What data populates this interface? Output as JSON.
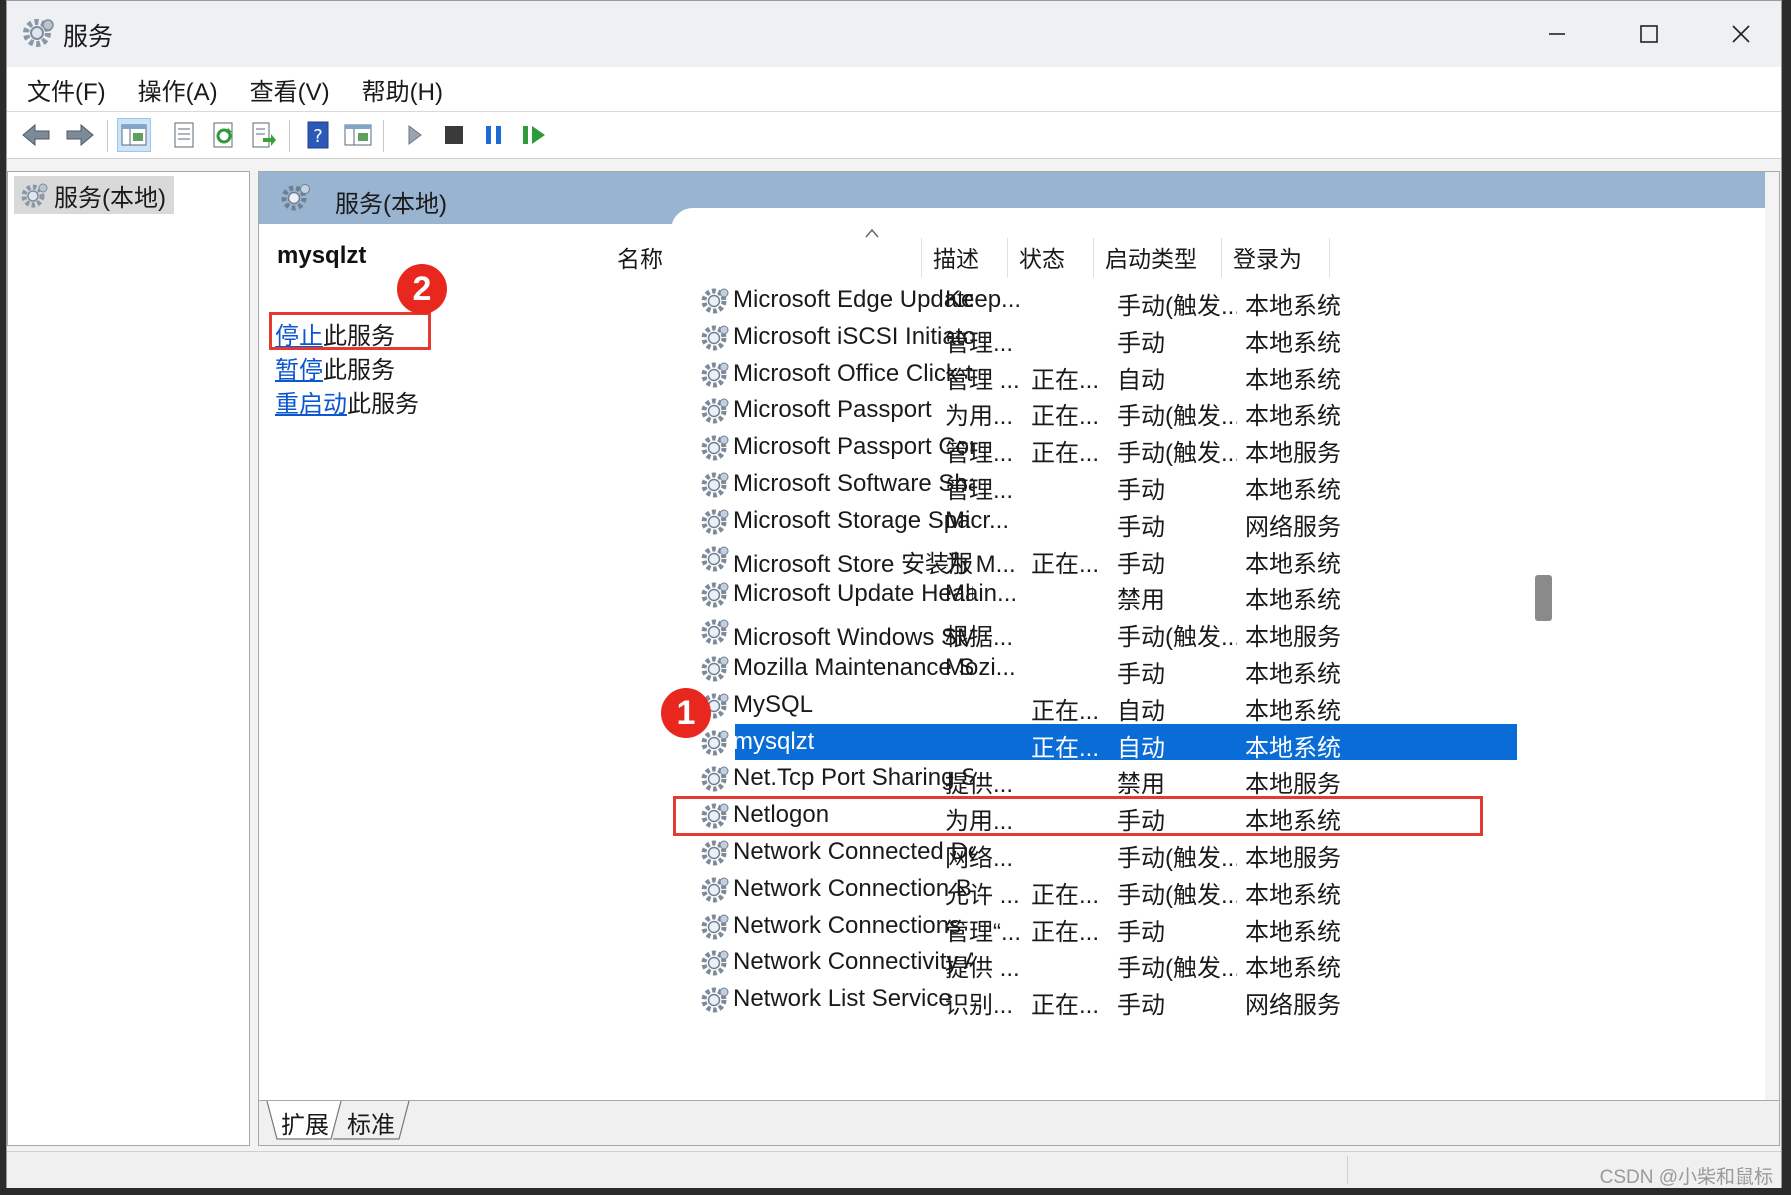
{
  "window": {
    "title": "服务"
  },
  "menu": [
    "文件(F)",
    "操作(A)",
    "查看(V)",
    "帮助(H)"
  ],
  "toolbar": {
    "buttons": [
      "back-icon",
      "forward-icon",
      "console-tree-icon",
      "properties-icon",
      "refresh-icon",
      "export-list-icon",
      "help-icon",
      "details-view-icon",
      "start-service-icon",
      "stop-service-icon",
      "pause-service-icon",
      "resume-service-icon"
    ]
  },
  "tree": {
    "root_label": "服务(本地)"
  },
  "panel": {
    "header": "服务(本地)",
    "selected_service": "mysqlzt",
    "actions": [
      {
        "link": "停止",
        "suffix": "此服务"
      },
      {
        "link": "暂停",
        "suffix": "此服务"
      },
      {
        "link": "重启动",
        "suffix": "此服务"
      }
    ]
  },
  "annotations": {
    "badge1": "1",
    "badge2": "2"
  },
  "table": {
    "columns": [
      "名称",
      "描述",
      "状态",
      "启动类型",
      "登录为"
    ],
    "rows": [
      [
        "Microsoft Edge Update Ser...",
        "Keep...",
        "",
        "手动(触发...",
        "本地系统"
      ],
      [
        "Microsoft iSCSI Initiator Ser...",
        "管理...",
        "",
        "手动",
        "本地系统"
      ],
      [
        "Microsoft Office Click-to-R...",
        "管理 ...",
        "正在...",
        "自动",
        "本地系统"
      ],
      [
        "Microsoft Passport",
        "为用...",
        "正在...",
        "手动(触发...",
        "本地系统"
      ],
      [
        "Microsoft Passport Container",
        "管理...",
        "正在...",
        "手动(触发...",
        "本地服务"
      ],
      [
        "Microsoft Software Shado...",
        "管理...",
        "",
        "手动",
        "本地系统"
      ],
      [
        "Microsoft Storage Spaces S...",
        "Micr...",
        "",
        "手动",
        "网络服务"
      ],
      [
        "Microsoft Store 安装服务",
        "为 M...",
        "正在...",
        "手动",
        "本地系统"
      ],
      [
        "Microsoft Update Health S...",
        "Main...",
        "",
        "禁用",
        "本地系统"
      ],
      [
        "Microsoft Windows SMS 路...",
        "根据...",
        "",
        "手动(触发...",
        "本地服务"
      ],
      [
        "Mozilla Maintenance Service",
        "Mozi...",
        "",
        "手动",
        "本地系统"
      ],
      [
        "MySQL",
        "",
        "正在...",
        "自动",
        "本地系统"
      ],
      [
        "mysqlzt",
        "",
        "正在...",
        "自动",
        "本地系统"
      ],
      [
        "Net.Tcp Port Sharing Service",
        "提供...",
        "",
        "禁用",
        "本地服务"
      ],
      [
        "Netlogon",
        "为用...",
        "",
        "手动",
        "本地系统"
      ],
      [
        "Network Connected Devic...",
        "网络...",
        "",
        "手动(触发...",
        "本地服务"
      ],
      [
        "Network Connection Broker",
        "允许 ...",
        "正在...",
        "手动(触发...",
        "本地系统"
      ],
      [
        "Network Connections",
        "管理“...",
        "正在...",
        "手动",
        "本地系统"
      ],
      [
        "Network Connectivity Assis...",
        "提供 ...",
        "",
        "手动(触发...",
        "本地系统"
      ],
      [
        "Network List Service",
        "识别...",
        "正在...",
        "手动",
        "网络服务"
      ]
    ],
    "selected_index": 12,
    "highlighted_index": 11
  },
  "bottom_tabs": [
    "扩展",
    "标准"
  ],
  "watermark": "CSDN @小柴和鼠标",
  "colors": {
    "selection": "#0a6cd6",
    "annotation": "#e53a2f",
    "header_band": "#98b4d0",
    "link": "#0b57d0"
  }
}
